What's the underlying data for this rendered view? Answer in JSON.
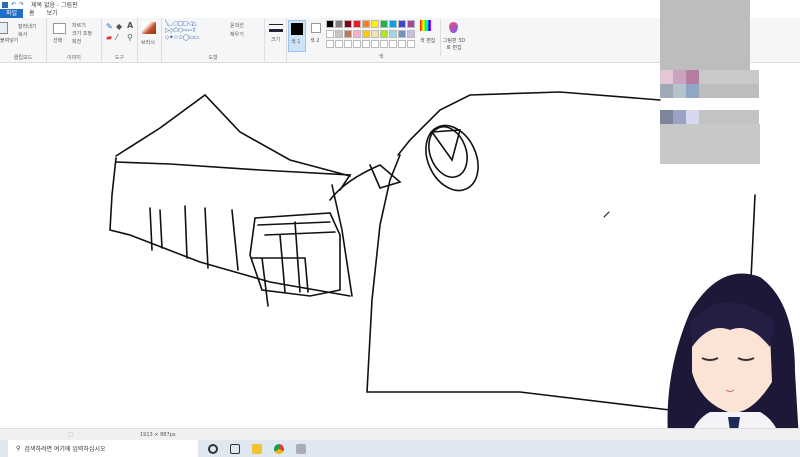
{
  "window": {
    "title": "제목 없음 - 그림판"
  },
  "tabs": [
    {
      "label": "파일"
    },
    {
      "label": "홈"
    },
    {
      "label": "보기"
    }
  ],
  "ribbon": {
    "clipboard": {
      "label": "클립보드",
      "paste": "붙여넣기",
      "cut": "잘라내기",
      "copy": "복사"
    },
    "image": {
      "label": "이미지",
      "select": "선택",
      "crop": "자르기",
      "resize": "크기 조정",
      "rotate": "회전"
    },
    "tools": {
      "label": "도구"
    },
    "brushes": {
      "label": "브러시"
    },
    "shapes": {
      "label": "도형",
      "outline": "윤곽선",
      "fill": "채우기"
    },
    "size": {
      "label": "크기"
    },
    "color1": {
      "label": "색 1"
    },
    "color2": {
      "label": "색 2"
    },
    "colors": {
      "label": "색",
      "edit": "색 편집"
    },
    "paint3d": {
      "label": "그림판 3D로 편집"
    },
    "palette": [
      "#000000",
      "#7f7f7f",
      "#880015",
      "#ed1c24",
      "#ff7f27",
      "#fff200",
      "#22b14c",
      "#00a2e8",
      "#3f48cc",
      "#a349a4",
      "#ffffff",
      "#c3c3c3",
      "#b97a57",
      "#ffaec9",
      "#ffc90e",
      "#efe4b0",
      "#b5e61d",
      "#99d9ea",
      "#7092be",
      "#c8bfe7"
    ]
  },
  "status": {
    "size": "1913 × 887px"
  },
  "taskbar": {
    "search_placeholder": "검색하려면 여기에 입력하십시오"
  }
}
